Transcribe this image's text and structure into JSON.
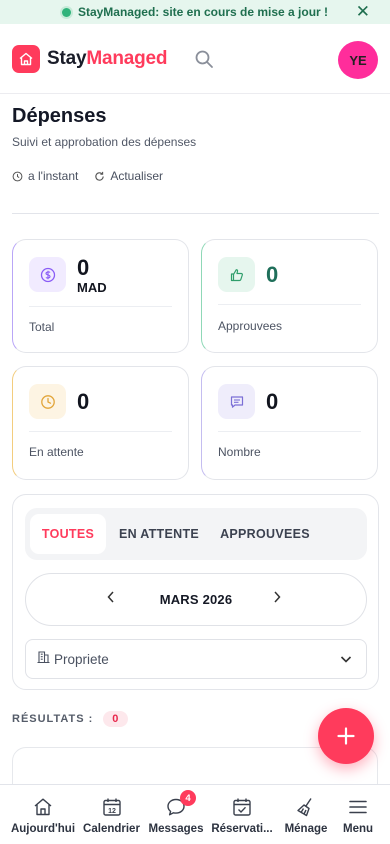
{
  "banner": {
    "text": "StayManaged: site en cours de mise a jour !",
    "close": "✕"
  },
  "header": {
    "brand_part1": "Stay",
    "brand_part2": "Managed",
    "avatar_initials": "YE"
  },
  "page": {
    "title": "Dépenses",
    "subtitle": "Suivi et approbation des dépenses",
    "updated": "a l'instant",
    "refresh_label": "Actualiser"
  },
  "stats": [
    {
      "value": "0",
      "unit": "MAD",
      "label": "Total",
      "icon": "currency-icon"
    },
    {
      "value": "0",
      "label": "Approuvees",
      "icon": "thumbs-up-icon"
    },
    {
      "value": "0",
      "label": "En attente",
      "icon": "clock-icon"
    },
    {
      "value": "0",
      "label": "Nombre",
      "icon": "receipt-icon"
    }
  ],
  "filters": {
    "tabs": [
      {
        "label": "TOUTES"
      },
      {
        "label": "EN ATTENTE"
      },
      {
        "label": "APPROUVEES"
      }
    ],
    "active_tab": "TOUTES",
    "month": "MARS 2026",
    "property_select": "Propriete"
  },
  "results": {
    "label": "RÉSULTATS :",
    "count": "0"
  },
  "nav": [
    {
      "label": "Aujourd'hui",
      "icon": "home-icon"
    },
    {
      "label": "Calendrier",
      "icon": "calendar-icon",
      "day": "12"
    },
    {
      "label": "Messages",
      "icon": "chat-icon",
      "badge": "4"
    },
    {
      "label": "Réservati...",
      "icon": "calendar-check-icon"
    },
    {
      "label": "Ménage",
      "icon": "broom-icon"
    },
    {
      "label": "Menu",
      "icon": "menu-icon"
    }
  ],
  "colors": {
    "accent": "#ff3b5c",
    "avatar": "#ff2d9b",
    "banner_bg": "#e6f6ee",
    "approved": "#2f9e6b",
    "pending": "#e2a53a",
    "count": "#7b6fd6",
    "total": "#8a5cf6"
  }
}
